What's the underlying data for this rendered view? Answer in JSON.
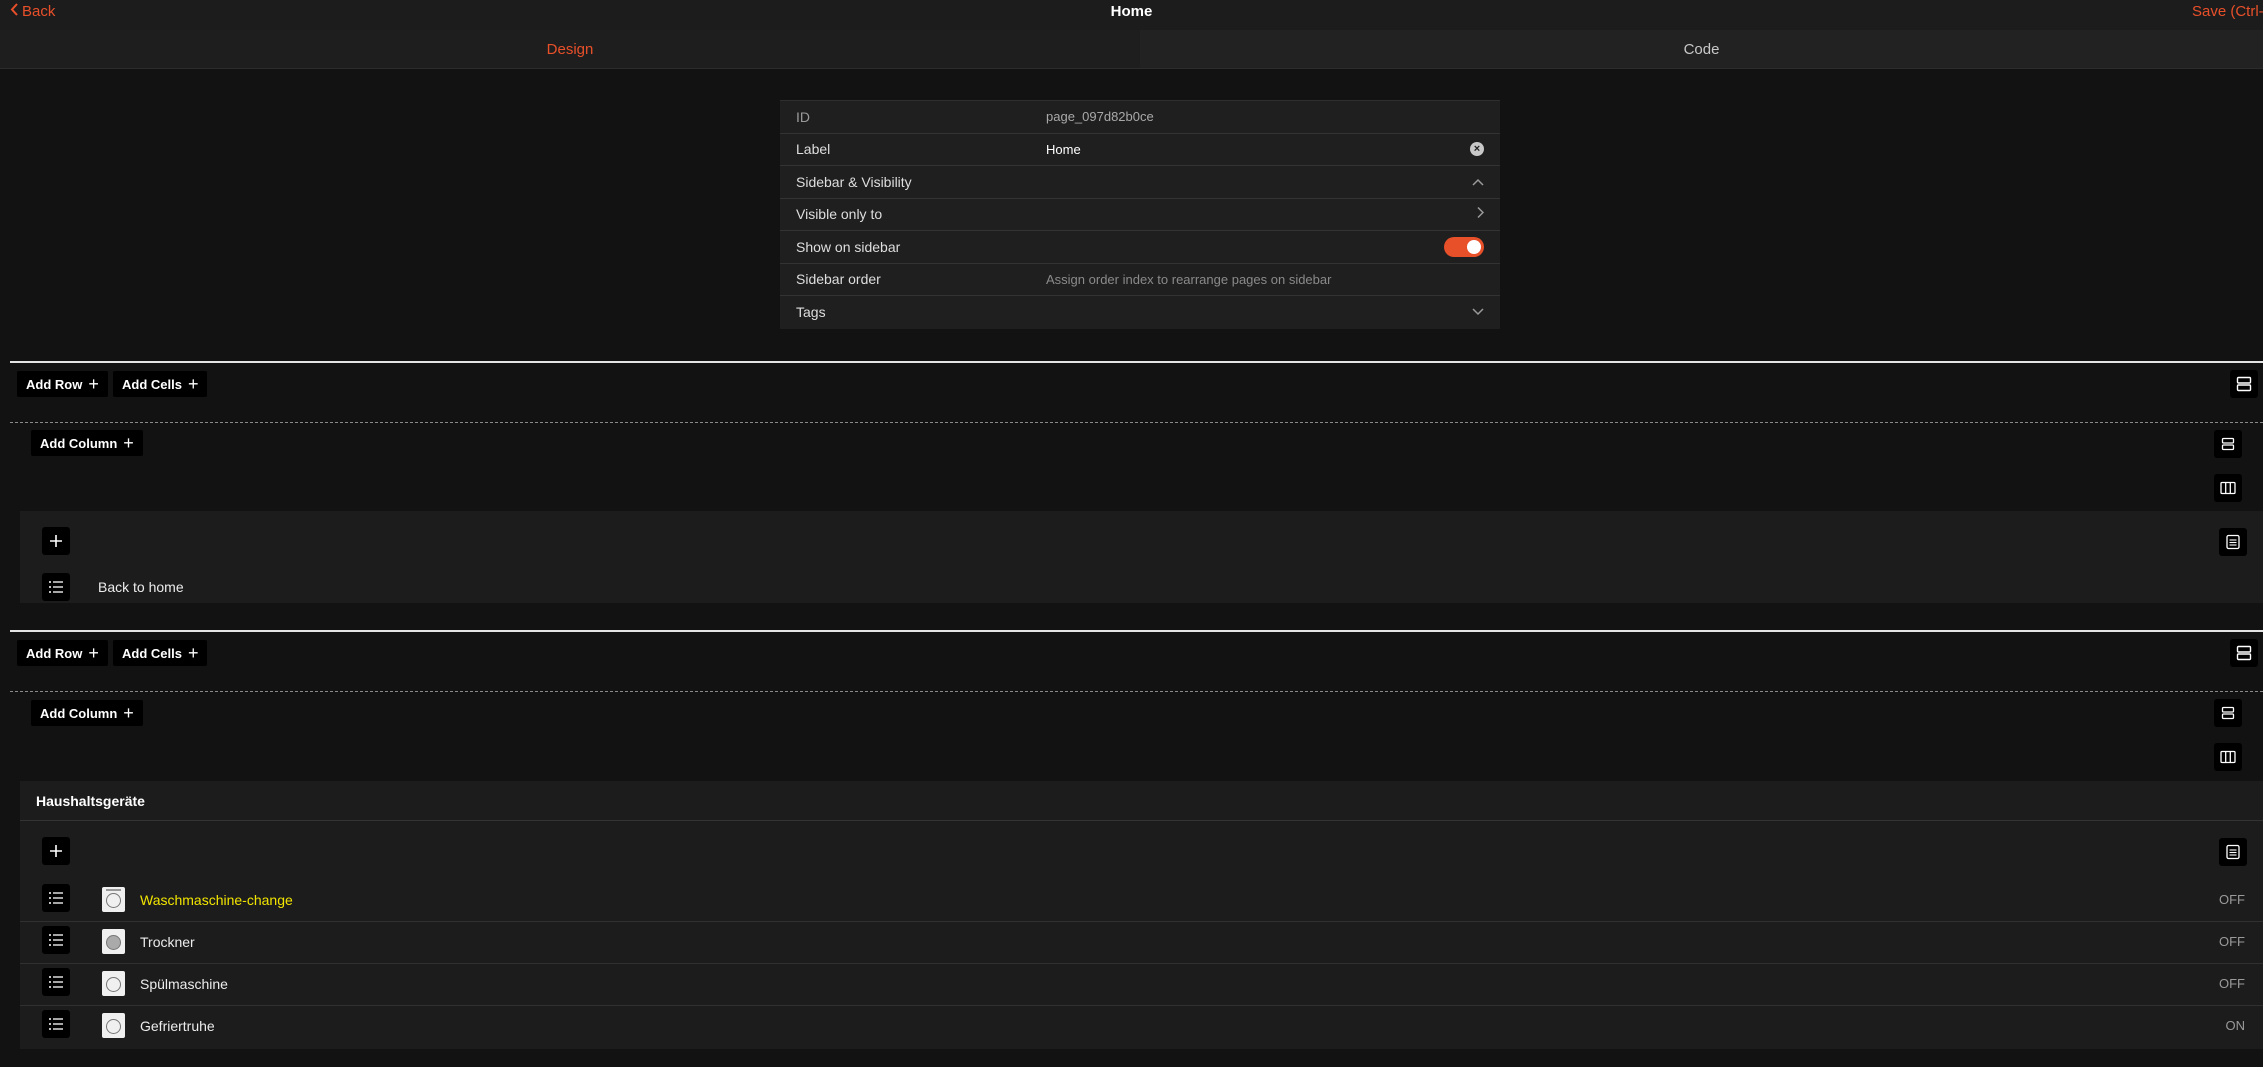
{
  "topbar": {
    "back_label": "Back",
    "title": "Home",
    "save_label": "Save (Ctrl-S)"
  },
  "tabs": [
    {
      "label": "Design",
      "active": true
    },
    {
      "label": "Code",
      "active": false
    }
  ],
  "properties": {
    "id_label": "ID",
    "id_value": "page_097d82b0ce",
    "label_label": "Label",
    "label_value": "Home",
    "sidebar_visibility_label": "Sidebar & Visibility",
    "visible_only_to_label": "Visible only to",
    "show_on_sidebar_label": "Show on sidebar",
    "show_on_sidebar": true,
    "sidebar_order_label": "Sidebar order",
    "sidebar_order_placeholder": "Assign order index to rearrange pages on sidebar",
    "tags_label": "Tags"
  },
  "sections": [
    {
      "add_row_label": "Add Row",
      "add_cells_label": "Add Cells",
      "add_column_label": "Add Column",
      "cell": {
        "item_label": "Back to home"
      }
    },
    {
      "add_row_label": "Add Row",
      "add_cells_label": "Add Cells",
      "add_column_label": "Add Column",
      "cell": {
        "title": "Haushaltsgeräte",
        "devices": [
          {
            "name": "Waschmaschine-change",
            "state": "OFF",
            "highlighted": true
          },
          {
            "name": "Trockner",
            "state": "OFF",
            "highlighted": false
          },
          {
            "name": "Spülmaschine",
            "state": "OFF",
            "highlighted": false
          },
          {
            "name": "Gefriertruhe",
            "state": "ON",
            "highlighted": false
          }
        ]
      }
    }
  ],
  "colors": {
    "accent": "#e8502a",
    "highlight": "#f2e500",
    "background": "#121212"
  },
  "icons": {
    "back": "chevron-left-icon",
    "clear": "clear-circle-icon",
    "collapse": "chevron-up-icon",
    "expand": "chevron-down-icon",
    "navigate": "chevron-right-icon",
    "row_settings": "rows-icon",
    "column_layout": "columns-icon",
    "cell_settings": "card-icon",
    "drag": "list-icon",
    "add": "plus-icon",
    "device": "appliance-icon"
  }
}
